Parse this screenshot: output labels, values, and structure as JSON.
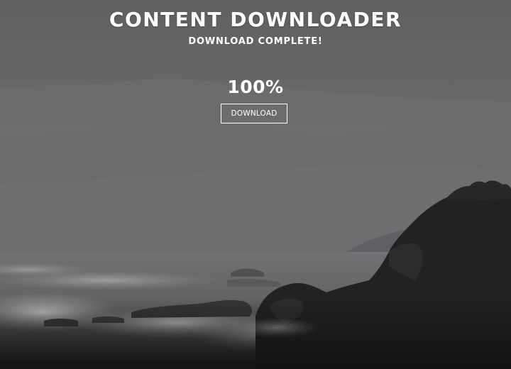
{
  "header": {
    "title": "CONTENT DOWNLOADER",
    "status": "DOWNLOAD COMPLETE!"
  },
  "progress": {
    "label": "100%",
    "value": 1.0
  },
  "actions": {
    "download_label": "DOWNLOAD"
  },
  "theme": {
    "text_color": "#ffffff",
    "sky_color": "#626467",
    "rock_color": "#141414",
    "background": "grayscale foggy coastal landscape with dark cliffs and crashing waves"
  }
}
